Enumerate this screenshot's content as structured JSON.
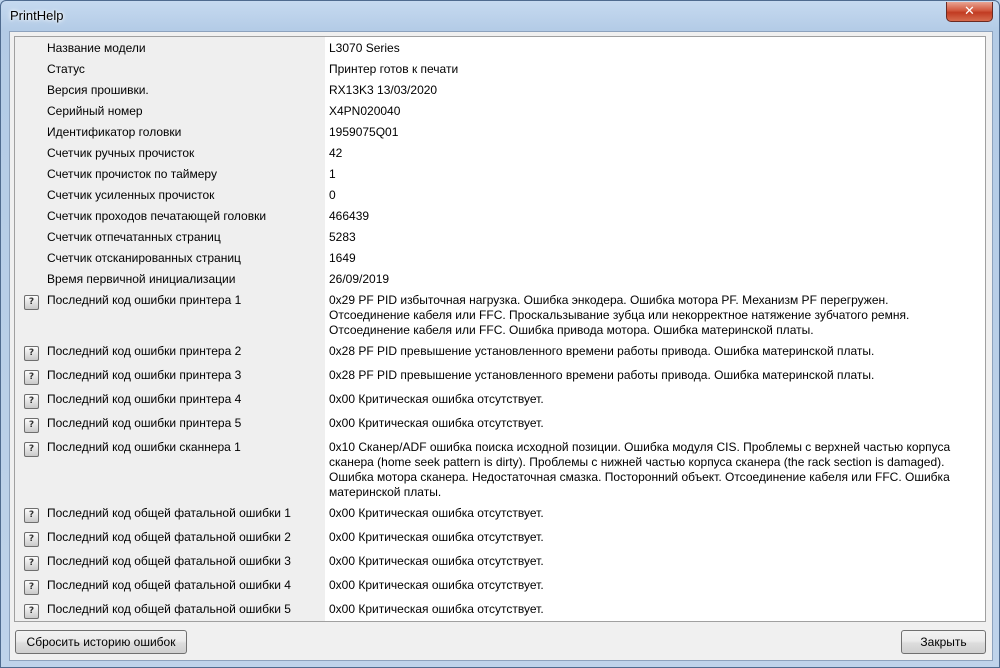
{
  "window": {
    "title": "PrintHelp",
    "close_glyph": "✕"
  },
  "rows": [
    {
      "label": "Название модели",
      "value": "L3070 Series",
      "icon": false
    },
    {
      "label": "Статус",
      "value": "Принтер готов к печати",
      "icon": false
    },
    {
      "label": "Версия прошивки.",
      "value": "RX13K3 13/03/2020",
      "icon": false
    },
    {
      "label": "Серийный номер",
      "value": "X4PN020040",
      "icon": false
    },
    {
      "label": "Идентификатор головки",
      "value": "1959075Q01",
      "icon": false
    },
    {
      "label": "Счетчик ручных прочисток",
      "value": "42",
      "icon": false
    },
    {
      "label": "Счетчик прочисток по таймеру",
      "value": "1",
      "icon": false
    },
    {
      "label": "Счетчик усиленных прочисток",
      "value": "0",
      "icon": false
    },
    {
      "label": "Счетчик проходов печатающей головки",
      "value": "466439",
      "icon": false
    },
    {
      "label": "Счетчик отпечатанных страниц",
      "value": "5283",
      "icon": false
    },
    {
      "label": "Счетчик отсканированных страниц",
      "value": "1649",
      "icon": false
    },
    {
      "label": "Время первичной инициализации",
      "value": "26/09/2019",
      "icon": false
    },
    {
      "label": "Последний код ошибки принтера 1",
      "value": "0x29 PF PID избыточная нагрузка. Ошибка энкодера. Ошибка мотора PF. Механизм PF перегружен. Отсоединение кабеля или FFC. Проскальзывание зубца или некорректное натяжение зубчатого ремня. Отсоединение кабеля или FFC. Ошибка привода мотора. Ошибка материнской платы.",
      "icon": true
    },
    {
      "label": "Последний код ошибки принтера 2",
      "value": "0x28 PF PID превышение установленного времени работы привода. Ошибка материнской платы.",
      "icon": true
    },
    {
      "label": "Последний код ошибки принтера 3",
      "value": "0x28 PF PID превышение установленного времени работы привода. Ошибка материнской платы.",
      "icon": true
    },
    {
      "label": "Последний код ошибки принтера 4",
      "value": "0x00 Критическая ошибка отсутствует.",
      "icon": true
    },
    {
      "label": "Последний код ошибки принтера 5",
      "value": "0x00 Критическая ошибка отсутствует.",
      "icon": true
    },
    {
      "label": "Последний код ошибки сканнера 1",
      "value": "0x10 Сканер/ADF ошибка поиска исходной позиции. Ошибка модуля CIS. Проблемы с верхней частью корпуса сканера (home seek pattern is dirty). Проблемы с нижней частью корпуса сканера (the rack section is damaged). Ошибка мотора сканера. Недостаточная смазка. Посторонний объект. Отсоединение кабеля или FFC. Ошибка материнской платы.",
      "icon": true
    },
    {
      "label": "Последний код общей фатальной ошибки 1",
      "value": "0x00 Критическая ошибка отсутствует.",
      "icon": true
    },
    {
      "label": "Последний код общей фатальной ошибки 2",
      "value": "0x00 Критическая ошибка отсутствует.",
      "icon": true
    },
    {
      "label": "Последний код общей фатальной ошибки 3",
      "value": "0x00 Критическая ошибка отсутствует.",
      "icon": true
    },
    {
      "label": "Последний код общей фатальной ошибки 4",
      "value": "0x00 Критическая ошибка отсутствует.",
      "icon": true
    },
    {
      "label": "Последний код общей фатальной ошибки 5",
      "value": "0x00 Критическая ошибка отсутствует.",
      "icon": true
    }
  ],
  "icon_glyph": "?",
  "buttons": {
    "reset_label": "Сбросить историю ошибок",
    "close_label": "Закрыть"
  }
}
